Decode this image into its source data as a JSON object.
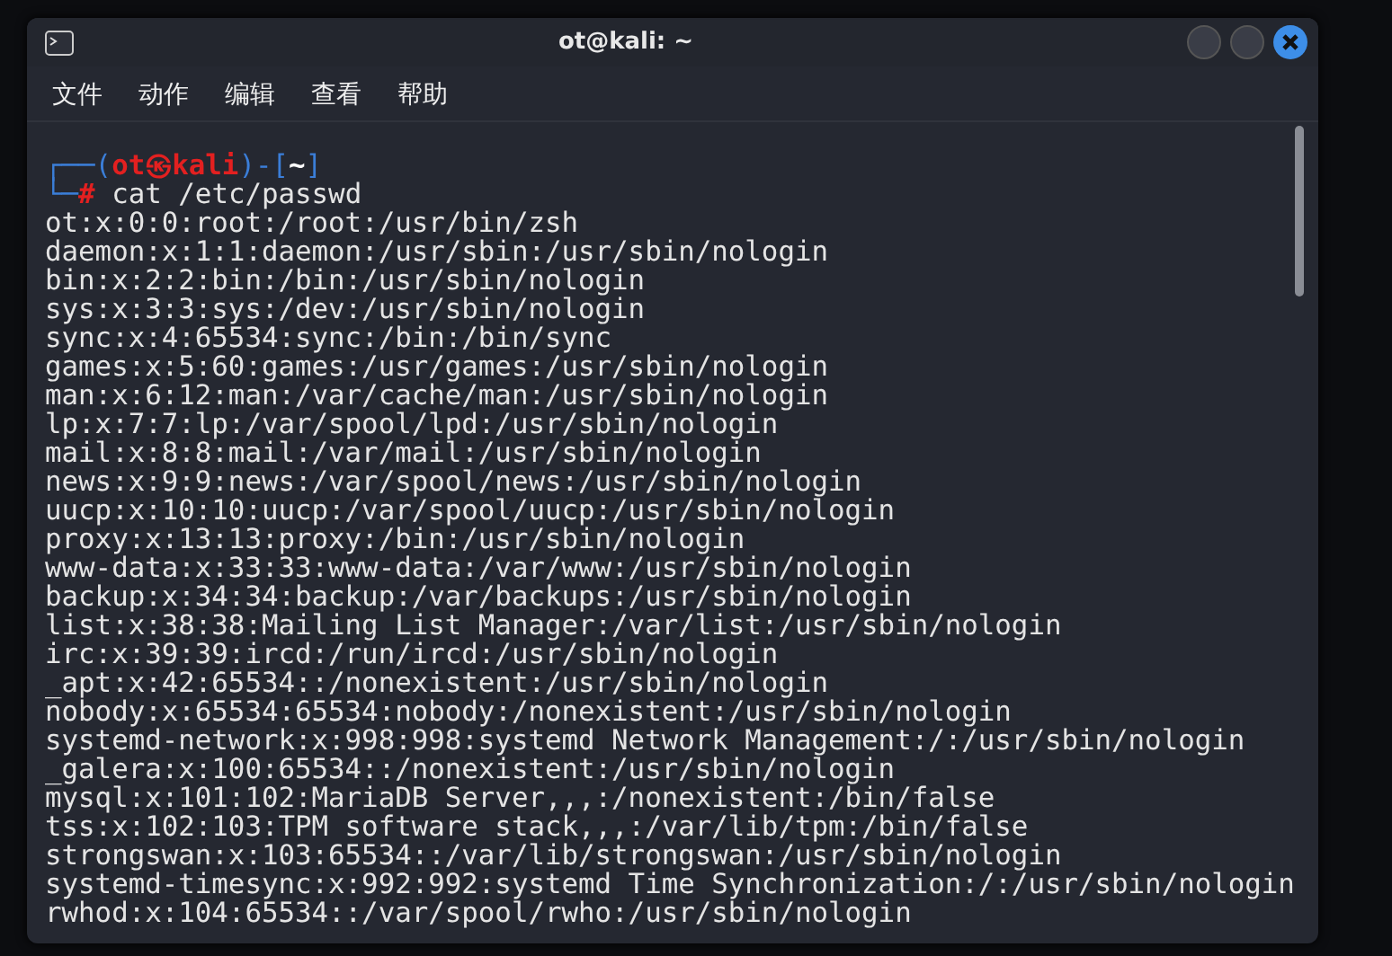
{
  "window": {
    "title": "ot@kali: ~"
  },
  "menu": [
    {
      "label": "文件"
    },
    {
      "label": "动作"
    },
    {
      "label": "编辑"
    },
    {
      "label": "查看"
    },
    {
      "label": "帮助"
    }
  ],
  "prompt": [
    [
      {
        "kind": "frame",
        "text": "┌──("
      },
      {
        "kind": "user",
        "text": "ot㉿kali"
      },
      {
        "kind": "frame",
        "text": ")-["
      },
      {
        "kind": "dir",
        "text": "~"
      },
      {
        "kind": "frame",
        "text": "]"
      }
    ],
    [
      {
        "kind": "frame",
        "text": "└─"
      },
      {
        "kind": "user",
        "text": "# "
      },
      {
        "kind": "command",
        "text": "cat /etc/passwd"
      }
    ]
  ],
  "output": [
    "ot:x:0:0:root:/root:/usr/bin/zsh",
    "daemon:x:1:1:daemon:/usr/sbin:/usr/sbin/nologin",
    "bin:x:2:2:bin:/bin:/usr/sbin/nologin",
    "sys:x:3:3:sys:/dev:/usr/sbin/nologin",
    "sync:x:4:65534:sync:/bin:/bin/sync",
    "games:x:5:60:games:/usr/games:/usr/sbin/nologin",
    "man:x:6:12:man:/var/cache/man:/usr/sbin/nologin",
    "lp:x:7:7:lp:/var/spool/lpd:/usr/sbin/nologin",
    "mail:x:8:8:mail:/var/mail:/usr/sbin/nologin",
    "news:x:9:9:news:/var/spool/news:/usr/sbin/nologin",
    "uucp:x:10:10:uucp:/var/spool/uucp:/usr/sbin/nologin",
    "proxy:x:13:13:proxy:/bin:/usr/sbin/nologin",
    "www-data:x:33:33:www-data:/var/www:/usr/sbin/nologin",
    "backup:x:34:34:backup:/var/backups:/usr/sbin/nologin",
    "list:x:38:38:Mailing List Manager:/var/list:/usr/sbin/nologin",
    "irc:x:39:39:ircd:/run/ircd:/usr/sbin/nologin",
    "_apt:x:42:65534::/nonexistent:/usr/sbin/nologin",
    "nobody:x:65534:65534:nobody:/nonexistent:/usr/sbin/nologin",
    "systemd-network:x:998:998:systemd Network Management:/:/usr/sbin/nologin",
    "_galera:x:100:65534::/nonexistent:/usr/sbin/nologin",
    "mysql:x:101:102:MariaDB Server,,,:/nonexistent:/bin/false",
    "tss:x:102:103:TPM software stack,,,:/var/lib/tpm:/bin/false",
    "strongswan:x:103:65534::/var/lib/strongswan:/usr/sbin/nologin",
    "systemd-timesync:x:992:992:systemd Time Synchronization:/:/usr/sbin/nologin",
    "rwhod:x:104:65534::/var/spool/rwho:/usr/sbin/nologin"
  ]
}
